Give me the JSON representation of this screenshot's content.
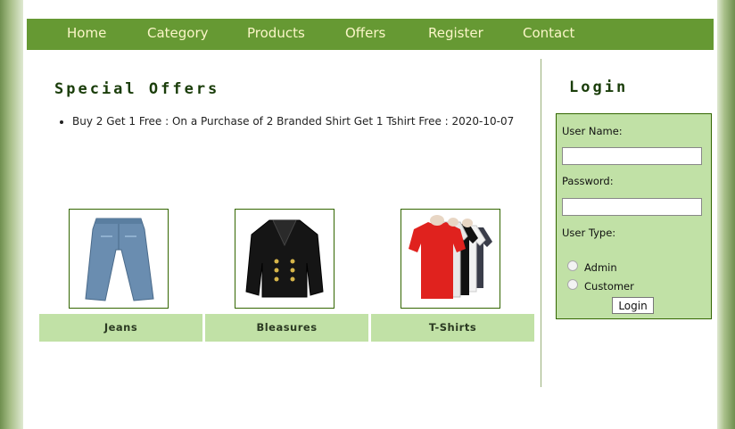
{
  "nav": {
    "items": [
      "Home",
      "Category",
      "Products",
      "Offers",
      "Register",
      "Contact"
    ]
  },
  "offers": {
    "title": "Special Offers",
    "items": [
      "Buy 2 Get 1 Free : On a Purchase of 2 Branded Shirt Get 1 Tshirt Free : 2020-10-07"
    ]
  },
  "categories": [
    {
      "label": "Jeans",
      "image": "jeans-image"
    },
    {
      "label": "Bleasures",
      "image": "blazer-image"
    },
    {
      "label": "T-Shirts",
      "image": "tshirts-image"
    }
  ],
  "login": {
    "title": "Login",
    "username_label": "User Name:",
    "username_value": "",
    "password_label": "Password:",
    "password_value": "",
    "usertype_label": "User Type:",
    "options": [
      "Admin",
      "Customer"
    ],
    "button": "Login"
  },
  "colors": {
    "nav_bg": "#669933",
    "nav_text": "#fbf6c8",
    "panel_bg": "#c1e1a6",
    "border": "#336600",
    "title_text": "#1a3d0a"
  }
}
